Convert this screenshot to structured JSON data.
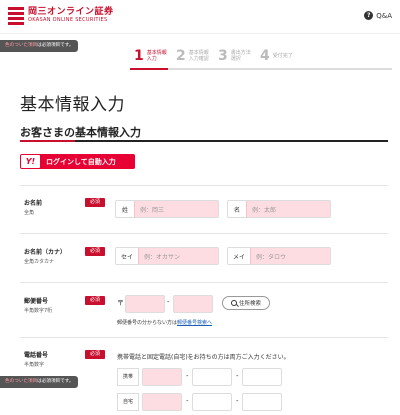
{
  "header": {
    "logo_name": "岡三オンライン証券",
    "logo_sub": "OKASAN ONLINE SECURITIES",
    "qa_label": "Q&A",
    "brand_color": "#c8102e"
  },
  "notice": {
    "required_prefix": "色のついた項目",
    "required_suffix": "は必須項目です。"
  },
  "steps": [
    {
      "num": "1",
      "label_line1": "基本情報",
      "label_line2": "入力",
      "active": true
    },
    {
      "num": "2",
      "label_line1": "基本情報",
      "label_line2": "入力確認",
      "active": false
    },
    {
      "num": "3",
      "label_line1": "書出方法",
      "label_line2": "選択",
      "active": false
    },
    {
      "num": "4",
      "label_line1": "受付完了",
      "label_line2": "",
      "active": false
    }
  ],
  "page_title": "基本情報入力",
  "section_title": "お客さまの基本情報入力",
  "yahoo": {
    "logo": "Y!",
    "label": "ログインして自動入力"
  },
  "required_badge": "必須",
  "name_row": {
    "label": "お名前",
    "sub": "全角",
    "last_prefix": "姓",
    "last_placeholder": "例：岡三",
    "first_prefix": "名",
    "first_placeholder": "例：太郎"
  },
  "kana_row": {
    "label": "お名前（カナ）",
    "sub": "全角カタカナ",
    "last_prefix": "セイ",
    "last_placeholder": "例：オカサン",
    "first_prefix": "メイ",
    "first_placeholder": "例：タロウ"
  },
  "postal_row": {
    "label": "郵便番号",
    "sub": "半角数字7桁",
    "mark": "〒",
    "search_button": "住所検索",
    "note_text": "郵便番号の分からない方は",
    "note_link": "郵便番号検索へ"
  },
  "phone_row": {
    "label": "電話番号",
    "sub": "半角数字",
    "note": "携帯電話と固定電話(自宅)をお持ちの方は両方ご入力ください。",
    "mobile_label": "携帯",
    "home_label": "自宅"
  },
  "dash": "-"
}
